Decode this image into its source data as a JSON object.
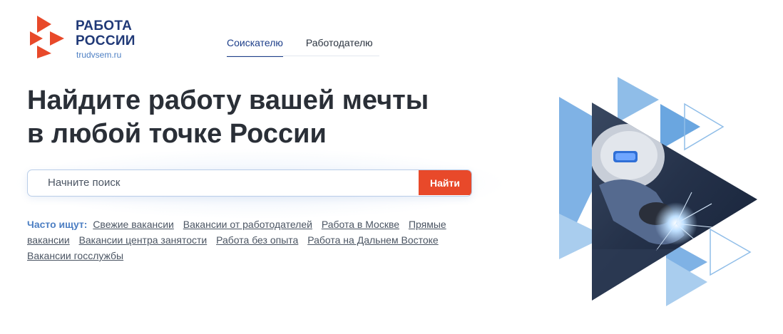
{
  "brand": {
    "title_line1": "РАБОТА",
    "title_line2": "РОССИИ",
    "site": "trudvsem.ru",
    "colors": {
      "accent_orange": "#e8492a",
      "brand_blue": "#203977",
      "light_blue": "#4d7fc3"
    }
  },
  "nav": {
    "tabs": [
      {
        "label": "Соискателю",
        "active": true
      },
      {
        "label": "Работодателю",
        "active": false
      }
    ]
  },
  "hero": {
    "title_line1": "Найдите работу вашей мечты",
    "title_line2": "в любой точке России"
  },
  "search": {
    "placeholder": "Начните поиск",
    "value": "",
    "button_label": "Найти"
  },
  "popular": {
    "label": "Часто ищут:",
    "links": [
      "Свежие вакансии",
      "Вакансии от работодателей",
      "Работа в Москве",
      "Прямые вакансии",
      "Вакансии центра занятости",
      "Работа без опыта",
      "Работа на Дальнем Востоке",
      "Вакансии госслужбы"
    ]
  },
  "icons": {
    "logo": "arrow-triangles-logo-icon",
    "hero": "welder-triangle-illustration"
  }
}
